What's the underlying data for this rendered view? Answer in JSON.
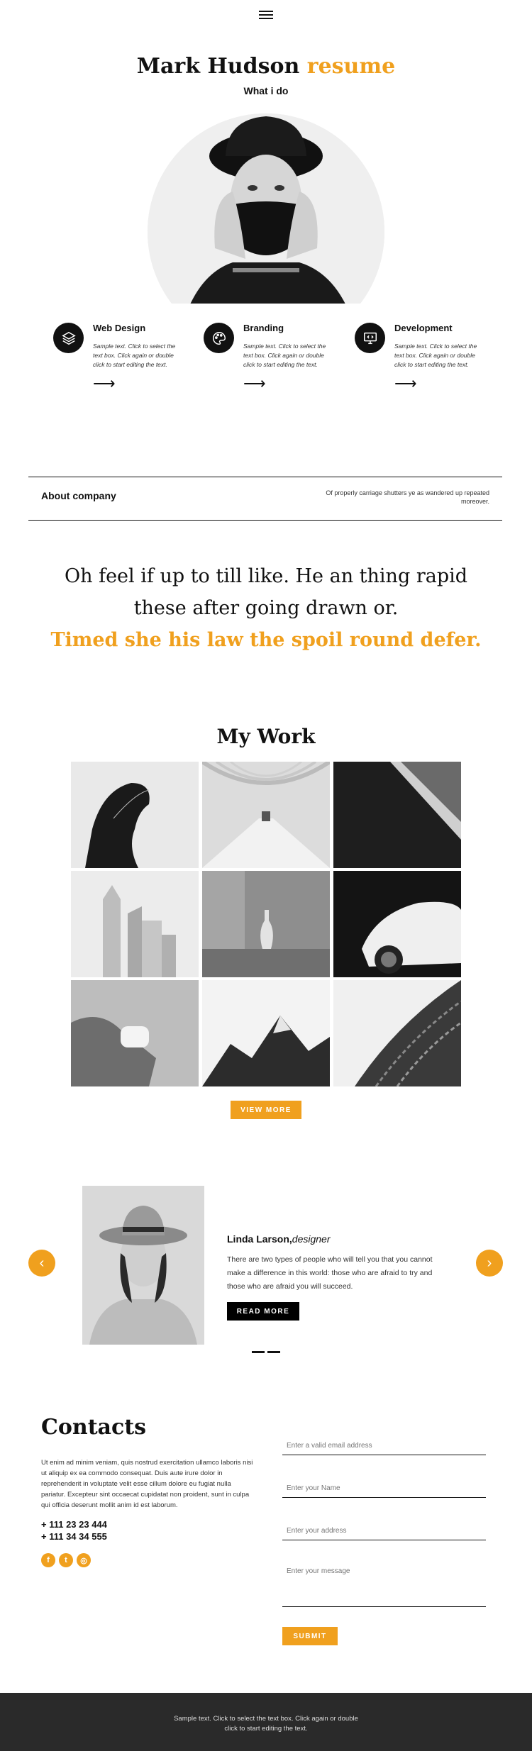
{
  "header": {
    "menu_icon": "hamburger-icon"
  },
  "hero": {
    "title_name": "Mark Hudson",
    "title_accent": "resume",
    "subtitle": "What i do"
  },
  "services": [
    {
      "icon": "layers-icon",
      "title": "Web Design",
      "text": "Sample text. Click to select the text box. Click again or double click to start editing the text."
    },
    {
      "icon": "palette-icon",
      "title": "Branding",
      "text": "Sample text. Click to select the text box. Click again or double click to start editing the text."
    },
    {
      "icon": "code-monitor-icon",
      "title": "Development",
      "text": "Sample text. Click to select the text box. Click again or double click to start editing the text."
    }
  ],
  "about": {
    "title": "About company",
    "text": "Of properly carriage shutters ye as wandered up repeated moreover."
  },
  "quote": {
    "line1": "Oh feel if up to till like. He an thing rapid",
    "line2": "these after going drawn or.",
    "line3": "Timed she his law the spoil round defer."
  },
  "work": {
    "title": "My Work",
    "tiles": [
      "woman-profile",
      "white-arches-corridor",
      "laptop-corner",
      "city-towers",
      "vase-on-table",
      "white-sports-car",
      "hand-holding-airpods",
      "mountain-peaks",
      "curved-facade"
    ],
    "view_more": "VIEW MORE"
  },
  "testimonial": {
    "name": "Linda Larson,",
    "role": "designer",
    "text": "There are two types of people who will tell you that you cannot make a difference in this world: those who are afraid to try and those who are afraid you will succeed.",
    "button": "READ MORE",
    "prev_icon": "chevron-left-icon",
    "next_icon": "chevron-right-icon"
  },
  "contacts": {
    "title": "Contacts",
    "text": "Ut enim ad minim veniam, quis nostrud exercitation ullamco laboris nisi ut aliquip ex ea commodo consequat. Duis aute irure dolor in reprehenderit in voluptate velit esse cillum dolore eu fugiat nulla pariatur. Excepteur sint occaecat cupidatat non proident, sunt in culpa qui officia deserunt mollit anim id est laborum.",
    "phone1": "+ 111 23 23 444",
    "phone2": "+ 111 34 34 555",
    "social_icons": [
      "facebook-icon",
      "twitter-icon",
      "instagram-icon"
    ],
    "email_placeholder": "Enter a valid email address",
    "name_placeholder": "Enter your Name",
    "address_placeholder": "Enter your address",
    "message_placeholder": "Enter your message",
    "submit": "SUBMIT"
  },
  "footer": {
    "text": "Sample text. Click to select the text box. Click again or double click to start editing the text."
  },
  "colors": {
    "accent": "#f0a01e",
    "dark": "#111111",
    "footer_bg": "#2a2a2a"
  }
}
